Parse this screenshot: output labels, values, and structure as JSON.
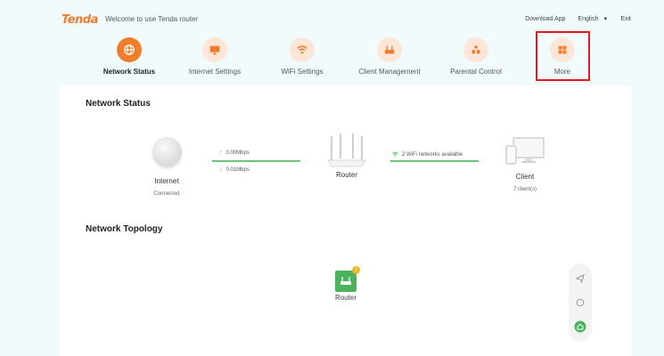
{
  "header": {
    "logo": "Tenda",
    "welcome": "Welcome to use Tenda router",
    "download_app": "Download App",
    "language": "English",
    "exit": "Exit"
  },
  "nav": {
    "items": [
      {
        "label": "Network Status",
        "icon": "globe-icon",
        "active": true
      },
      {
        "label": "Internet Settings",
        "icon": "monitor-icon",
        "active": false
      },
      {
        "label": "WiFi Settings",
        "icon": "wifi-icon",
        "active": false
      },
      {
        "label": "Client Management",
        "icon": "router-icon",
        "active": false
      },
      {
        "label": "Parental Control",
        "icon": "family-icon",
        "active": false
      },
      {
        "label": "More",
        "icon": "grid-icon",
        "active": false
      }
    ]
  },
  "network_status": {
    "title": "Network Status",
    "internet": {
      "label": "Internet",
      "status": "Connected"
    },
    "upload": "0.00Mbps",
    "download": "0.01Mbps",
    "router": {
      "label": "Router"
    },
    "wifi_info": "2 WiFi networks available",
    "client": {
      "label": "Client",
      "count": "7 client(s)"
    }
  },
  "topology": {
    "title": "Network Topology",
    "router_label": "Router",
    "badge": "!"
  },
  "colors": {
    "accent": "#f07d2c",
    "accent_light": "#fde6d7",
    "link_green": "#6cc57a",
    "highlight_red": "#e0191f",
    "background": "#f2fbfb"
  }
}
